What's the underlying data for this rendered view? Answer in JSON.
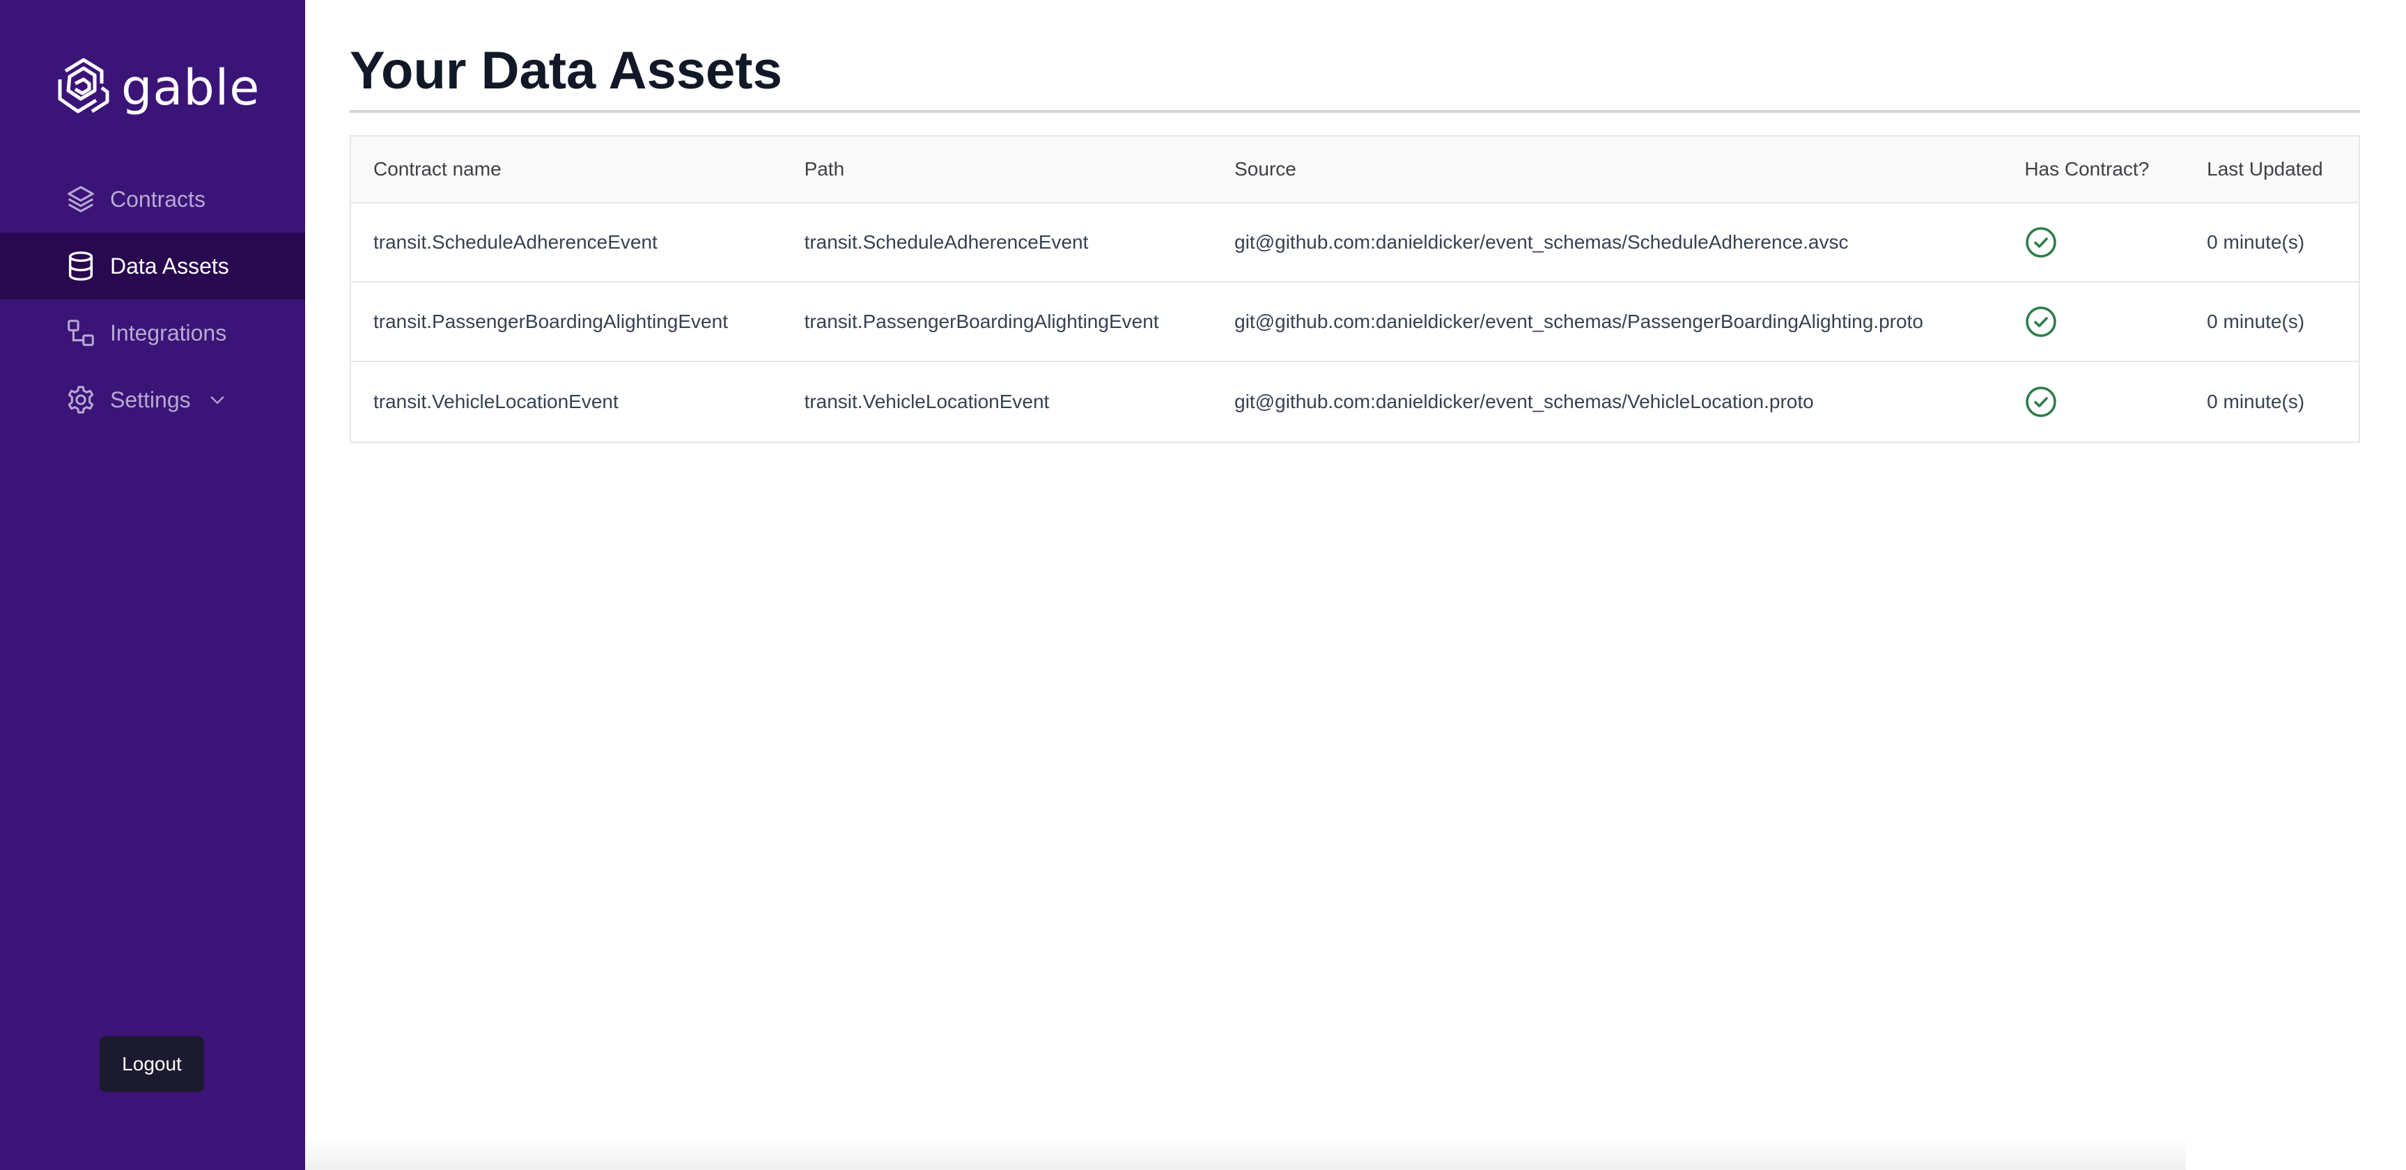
{
  "brand": {
    "name": "gable",
    "logo_icon": "gable-logo-icon"
  },
  "sidebar": {
    "items": [
      {
        "label": "Contracts",
        "icon": "layers-icon",
        "active": false
      },
      {
        "label": "Data Assets",
        "icon": "database-icon",
        "active": true
      },
      {
        "label": "Integrations",
        "icon": "integrations-icon",
        "active": false
      },
      {
        "label": "Settings",
        "icon": "gear-icon",
        "active": false,
        "has_dropdown": true
      }
    ],
    "logout_label": "Logout"
  },
  "main": {
    "title": "Your Data Assets",
    "table": {
      "headers": [
        "Contract name",
        "Path",
        "Source",
        "Has Contract?",
        "Last Updated"
      ],
      "rows": [
        {
          "contract_name": "transit.ScheduleAdherenceEvent",
          "path": "transit.ScheduleAdherenceEvent",
          "source": "git@github.com:danieldicker/event_schemas/ScheduleAdherence.avsc",
          "has_contract": true,
          "last_updated": "0 minute(s)"
        },
        {
          "contract_name": "transit.PassengerBoardingAlightingEvent",
          "path": "transit.PassengerBoardingAlightingEvent",
          "source": "git@github.com:danieldicker/event_schemas/PassengerBoardingAlighting.proto",
          "has_contract": true,
          "last_updated": "0 minute(s)"
        },
        {
          "contract_name": "transit.VehicleLocationEvent",
          "path": "transit.VehicleLocationEvent",
          "source": "git@github.com:danieldicker/event_schemas/VehicleLocation.proto",
          "has_contract": true,
          "last_updated": "0 minute(s)"
        }
      ]
    }
  },
  "colors": {
    "sidebar_bg": "#3b1478",
    "sidebar_active_bg": "#28084f",
    "check_green": "#2e7d4a",
    "logout_bg": "#1c1a2e"
  }
}
